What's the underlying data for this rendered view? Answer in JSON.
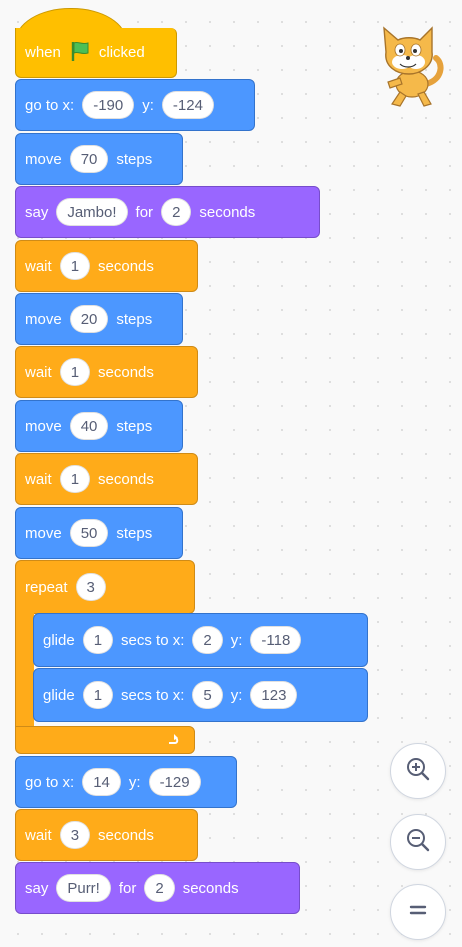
{
  "colors": {
    "motion": "#4c97ff",
    "looks": "#9966ff",
    "control": "#ffab19",
    "events": "#ffbf00"
  },
  "script": {
    "hat": {
      "when": "when",
      "clicked": "clicked",
      "flag_icon": "green-flag-icon"
    },
    "goto1": {
      "label": "go to x:",
      "x": "-190",
      "y_label": "y:",
      "y": "-124"
    },
    "move1": {
      "label": "move",
      "value": "70",
      "suffix": "steps"
    },
    "say1": {
      "label": "say",
      "text": "Jambo!",
      "for": "for",
      "secs": "2",
      "suffix": "seconds"
    },
    "wait1": {
      "label": "wait",
      "value": "1",
      "suffix": "seconds"
    },
    "move2": {
      "label": "move",
      "value": "20",
      "suffix": "steps"
    },
    "wait2": {
      "label": "wait",
      "value": "1",
      "suffix": "seconds"
    },
    "move3": {
      "label": "move",
      "value": "40",
      "suffix": "steps"
    },
    "wait3": {
      "label": "wait",
      "value": "1",
      "suffix": "seconds"
    },
    "move4": {
      "label": "move",
      "value": "50",
      "suffix": "steps"
    },
    "repeat": {
      "label": "repeat",
      "value": "3",
      "loop_icon": "loop-arrow-icon"
    },
    "glide1": {
      "label": "glide",
      "secs": "1",
      "mid": "secs to x:",
      "x": "2",
      "y_label": "y:",
      "y": "-118"
    },
    "glide2": {
      "label": "glide",
      "secs": "1",
      "mid": "secs to x:",
      "x": "5",
      "y_label": "y:",
      "y": "123"
    },
    "goto2": {
      "label": "go to x:",
      "x": "14",
      "y_label": "y:",
      "y": "-129"
    },
    "wait4": {
      "label": "wait",
      "value": "3",
      "suffix": "seconds"
    },
    "say2": {
      "label": "say",
      "text": "Purr!",
      "for": "for",
      "secs": "2",
      "suffix": "seconds"
    }
  },
  "controls": {
    "zoom_in_icon": "zoom-in-icon",
    "zoom_out_icon": "zoom-out-icon",
    "reset_icon": "zoom-reset-icon",
    "sprite_icon": "cat-sprite-icon"
  }
}
